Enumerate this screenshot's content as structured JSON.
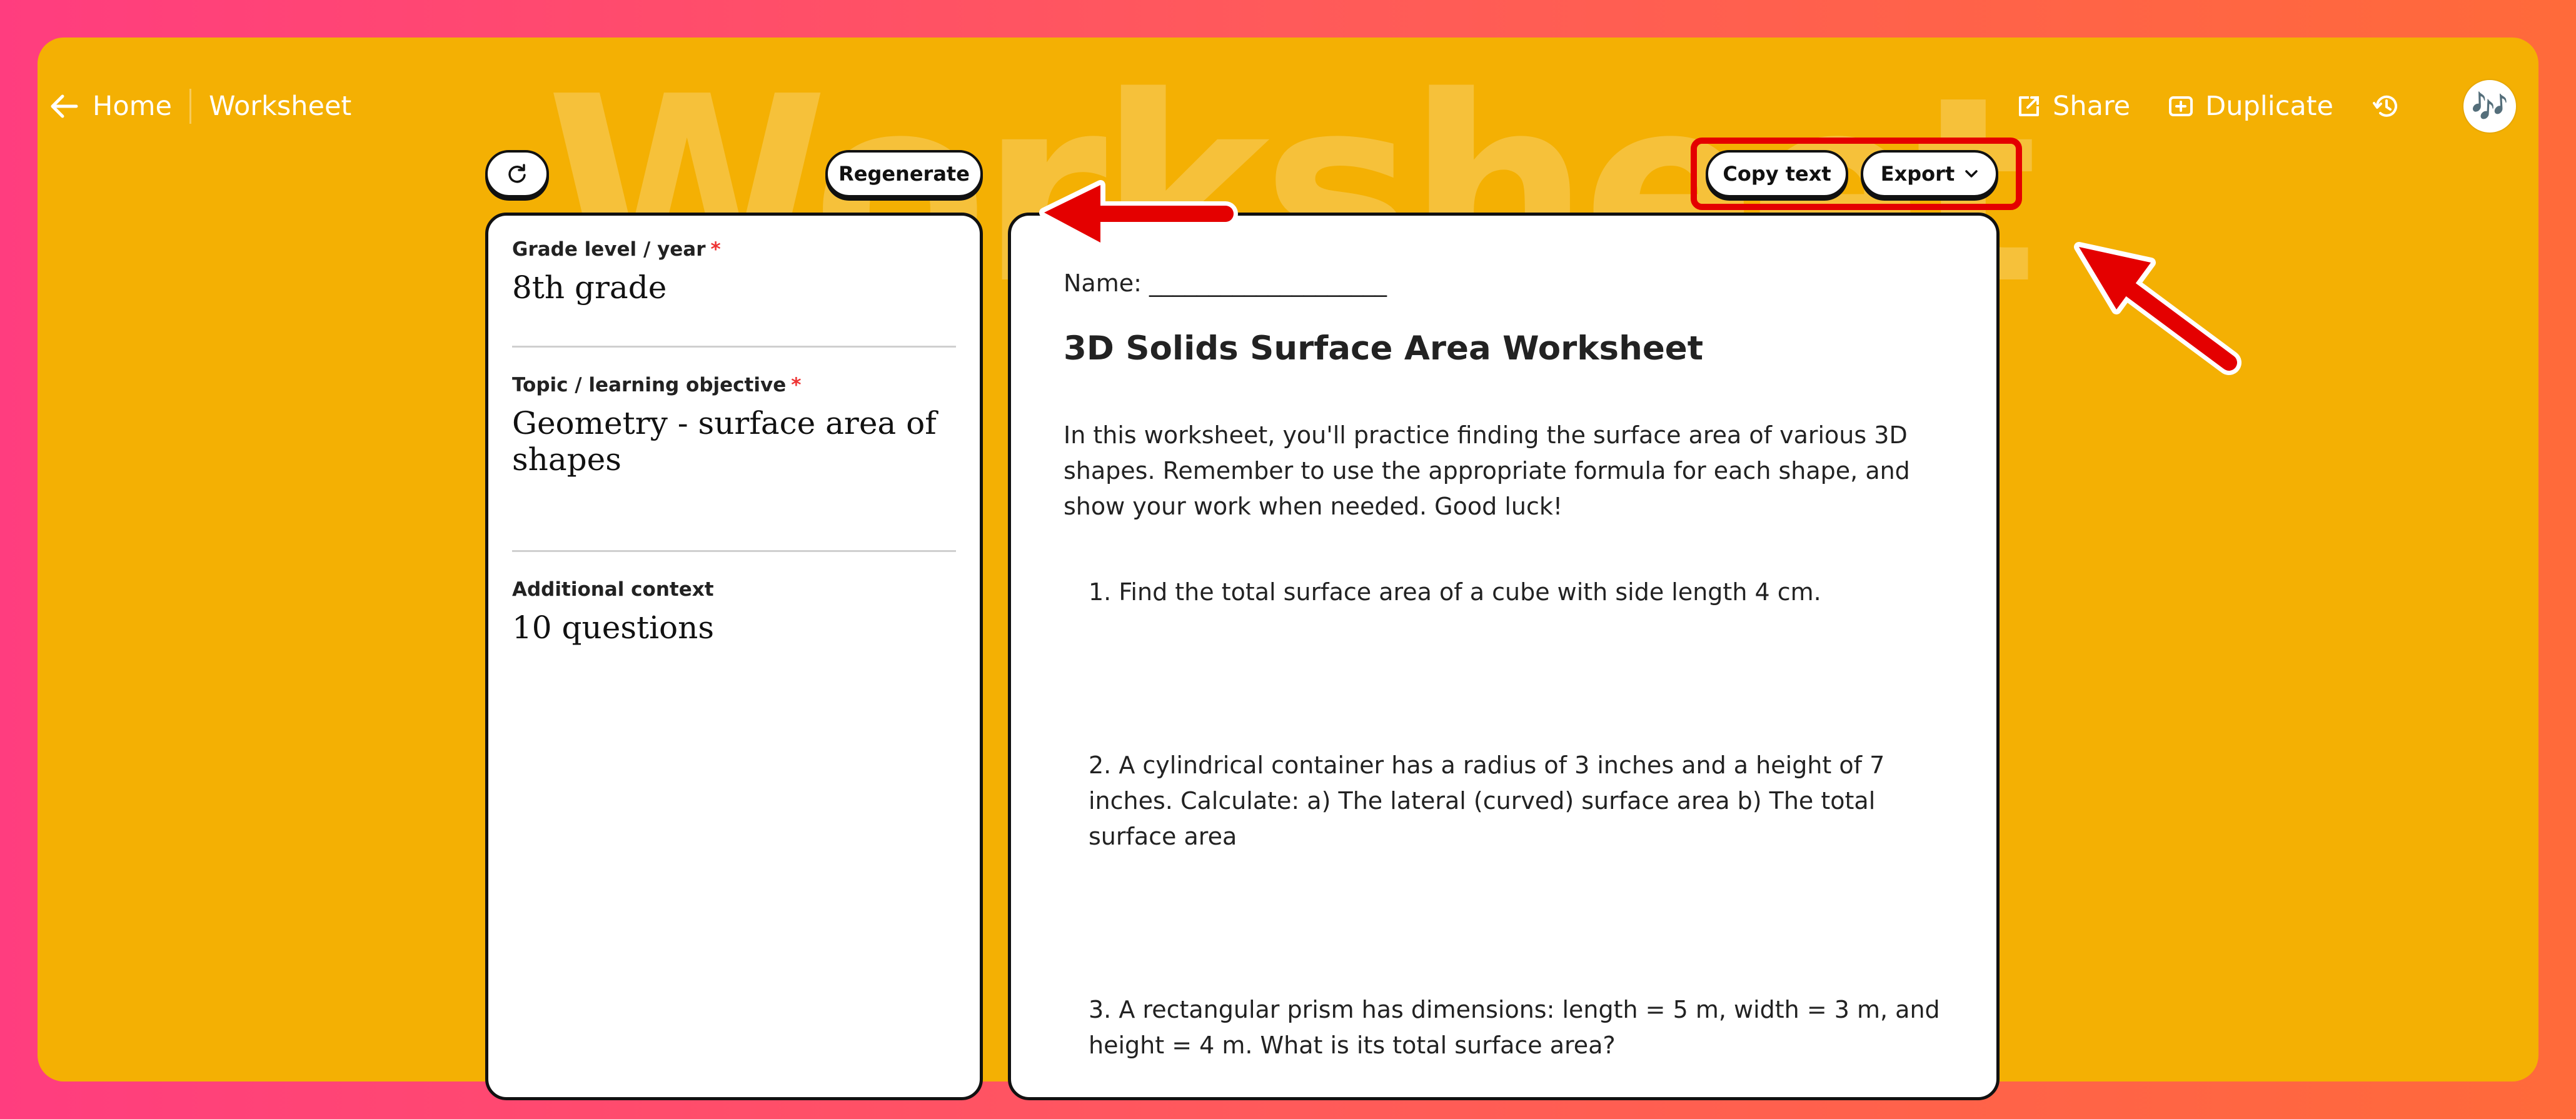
{
  "watermark": "Worksheet",
  "nav": {
    "home_label": "Home",
    "breadcrumb": "Worksheet",
    "share_label": "Share",
    "duplicate_label": "Duplicate",
    "avatar_glyph": "🎶"
  },
  "toolbar": {
    "refresh_icon": "↻",
    "regenerate_label": "Regenerate",
    "copy_text_label": "Copy text",
    "export_label": "Export",
    "export_chevron": "⌄"
  },
  "form": {
    "grade_label": "Grade level / year",
    "grade_value": "8th grade",
    "topic_label": "Topic / learning objective",
    "topic_value": "Geometry - surface area of shapes",
    "context_label": "Additional context",
    "context_value": "10 questions",
    "required_mark": "*"
  },
  "worksheet": {
    "name_line": "Name: ____________________",
    "title": "3D Solids Surface Area Worksheet",
    "intro": "In this worksheet, you'll practice finding the surface area of various 3D shapes. Remember to use the appropriate formula for each shape, and show your work when needed. Good luck!",
    "questions": [
      "1. Find the total surface area of a cube with side length 4 cm.",
      "2. A cylindrical container has a radius of 3 inches and a height of 7 inches. Calculate: a) The lateral (curved) surface area b) The total surface area",
      "3. A rectangular prism has dimensions: length = 5 m, width = 3 m, and height = 4 m. What is its total surface area?"
    ]
  },
  "colors": {
    "background_gradient_start": "#ff3d7f",
    "background_gradient_end": "#ff6a3a",
    "frame": "#f4b003",
    "annotation_red": "#e40000"
  }
}
